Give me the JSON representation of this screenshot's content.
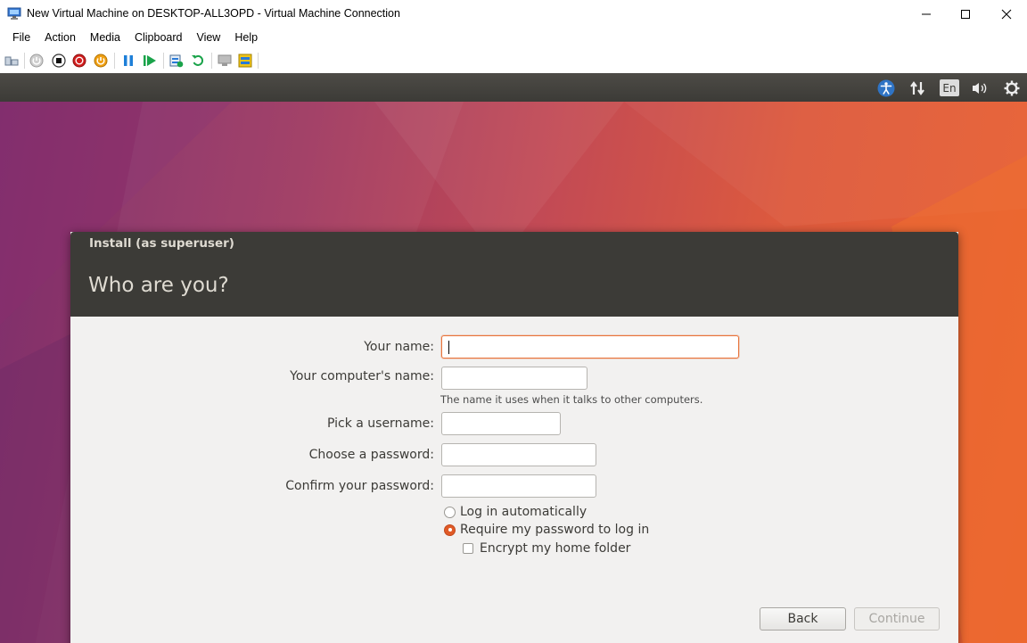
{
  "window": {
    "title": "New Virtual Machine on DESKTOP-ALL3OPD - Virtual Machine Connection",
    "icon": "vm-connection-icon"
  },
  "menu": {
    "items": [
      {
        "label": "File"
      },
      {
        "label": "Action"
      },
      {
        "label": "Media"
      },
      {
        "label": "Clipboard"
      },
      {
        "label": "View"
      },
      {
        "label": "Help"
      }
    ]
  },
  "toolbar": {
    "icons": [
      "ctrl-alt-del-icon",
      "start-icon",
      "turn-off-icon",
      "shutdown-icon",
      "save-icon",
      "pause-icon",
      "resume-icon",
      "checkpoint-icon",
      "revert-icon",
      "enhanced-session-icon",
      "share-icon"
    ]
  },
  "panel": {
    "language": "En",
    "icons": [
      "accessibility-icon",
      "network-icon",
      "keyboard-language-icon",
      "volume-icon",
      "settings-gear-icon"
    ]
  },
  "dialog": {
    "window_title": "Install (as superuser)",
    "heading": "Who are you?",
    "fields": {
      "name": {
        "label": "Your name:",
        "value": ""
      },
      "computer": {
        "label": "Your computer's name:",
        "value": "",
        "hint": "The name it uses when it talks to other computers."
      },
      "username": {
        "label": "Pick a username:",
        "value": ""
      },
      "password": {
        "label": "Choose a password:",
        "value": ""
      },
      "confirm": {
        "label": "Confirm your password:",
        "value": ""
      }
    },
    "options": {
      "auto_login": {
        "label": "Log in automatically",
        "selected": false
      },
      "require_password": {
        "label": "Require my password to log in",
        "selected": true
      },
      "encrypt_home": {
        "label": "Encrypt my home folder",
        "checked": false
      }
    },
    "buttons": {
      "back": "Back",
      "continue": "Continue"
    }
  },
  "colors": {
    "ubuntu_orange": "#e05a26",
    "panel_dark": "#3c3b37",
    "dialog_bg": "#f2f1f0"
  }
}
